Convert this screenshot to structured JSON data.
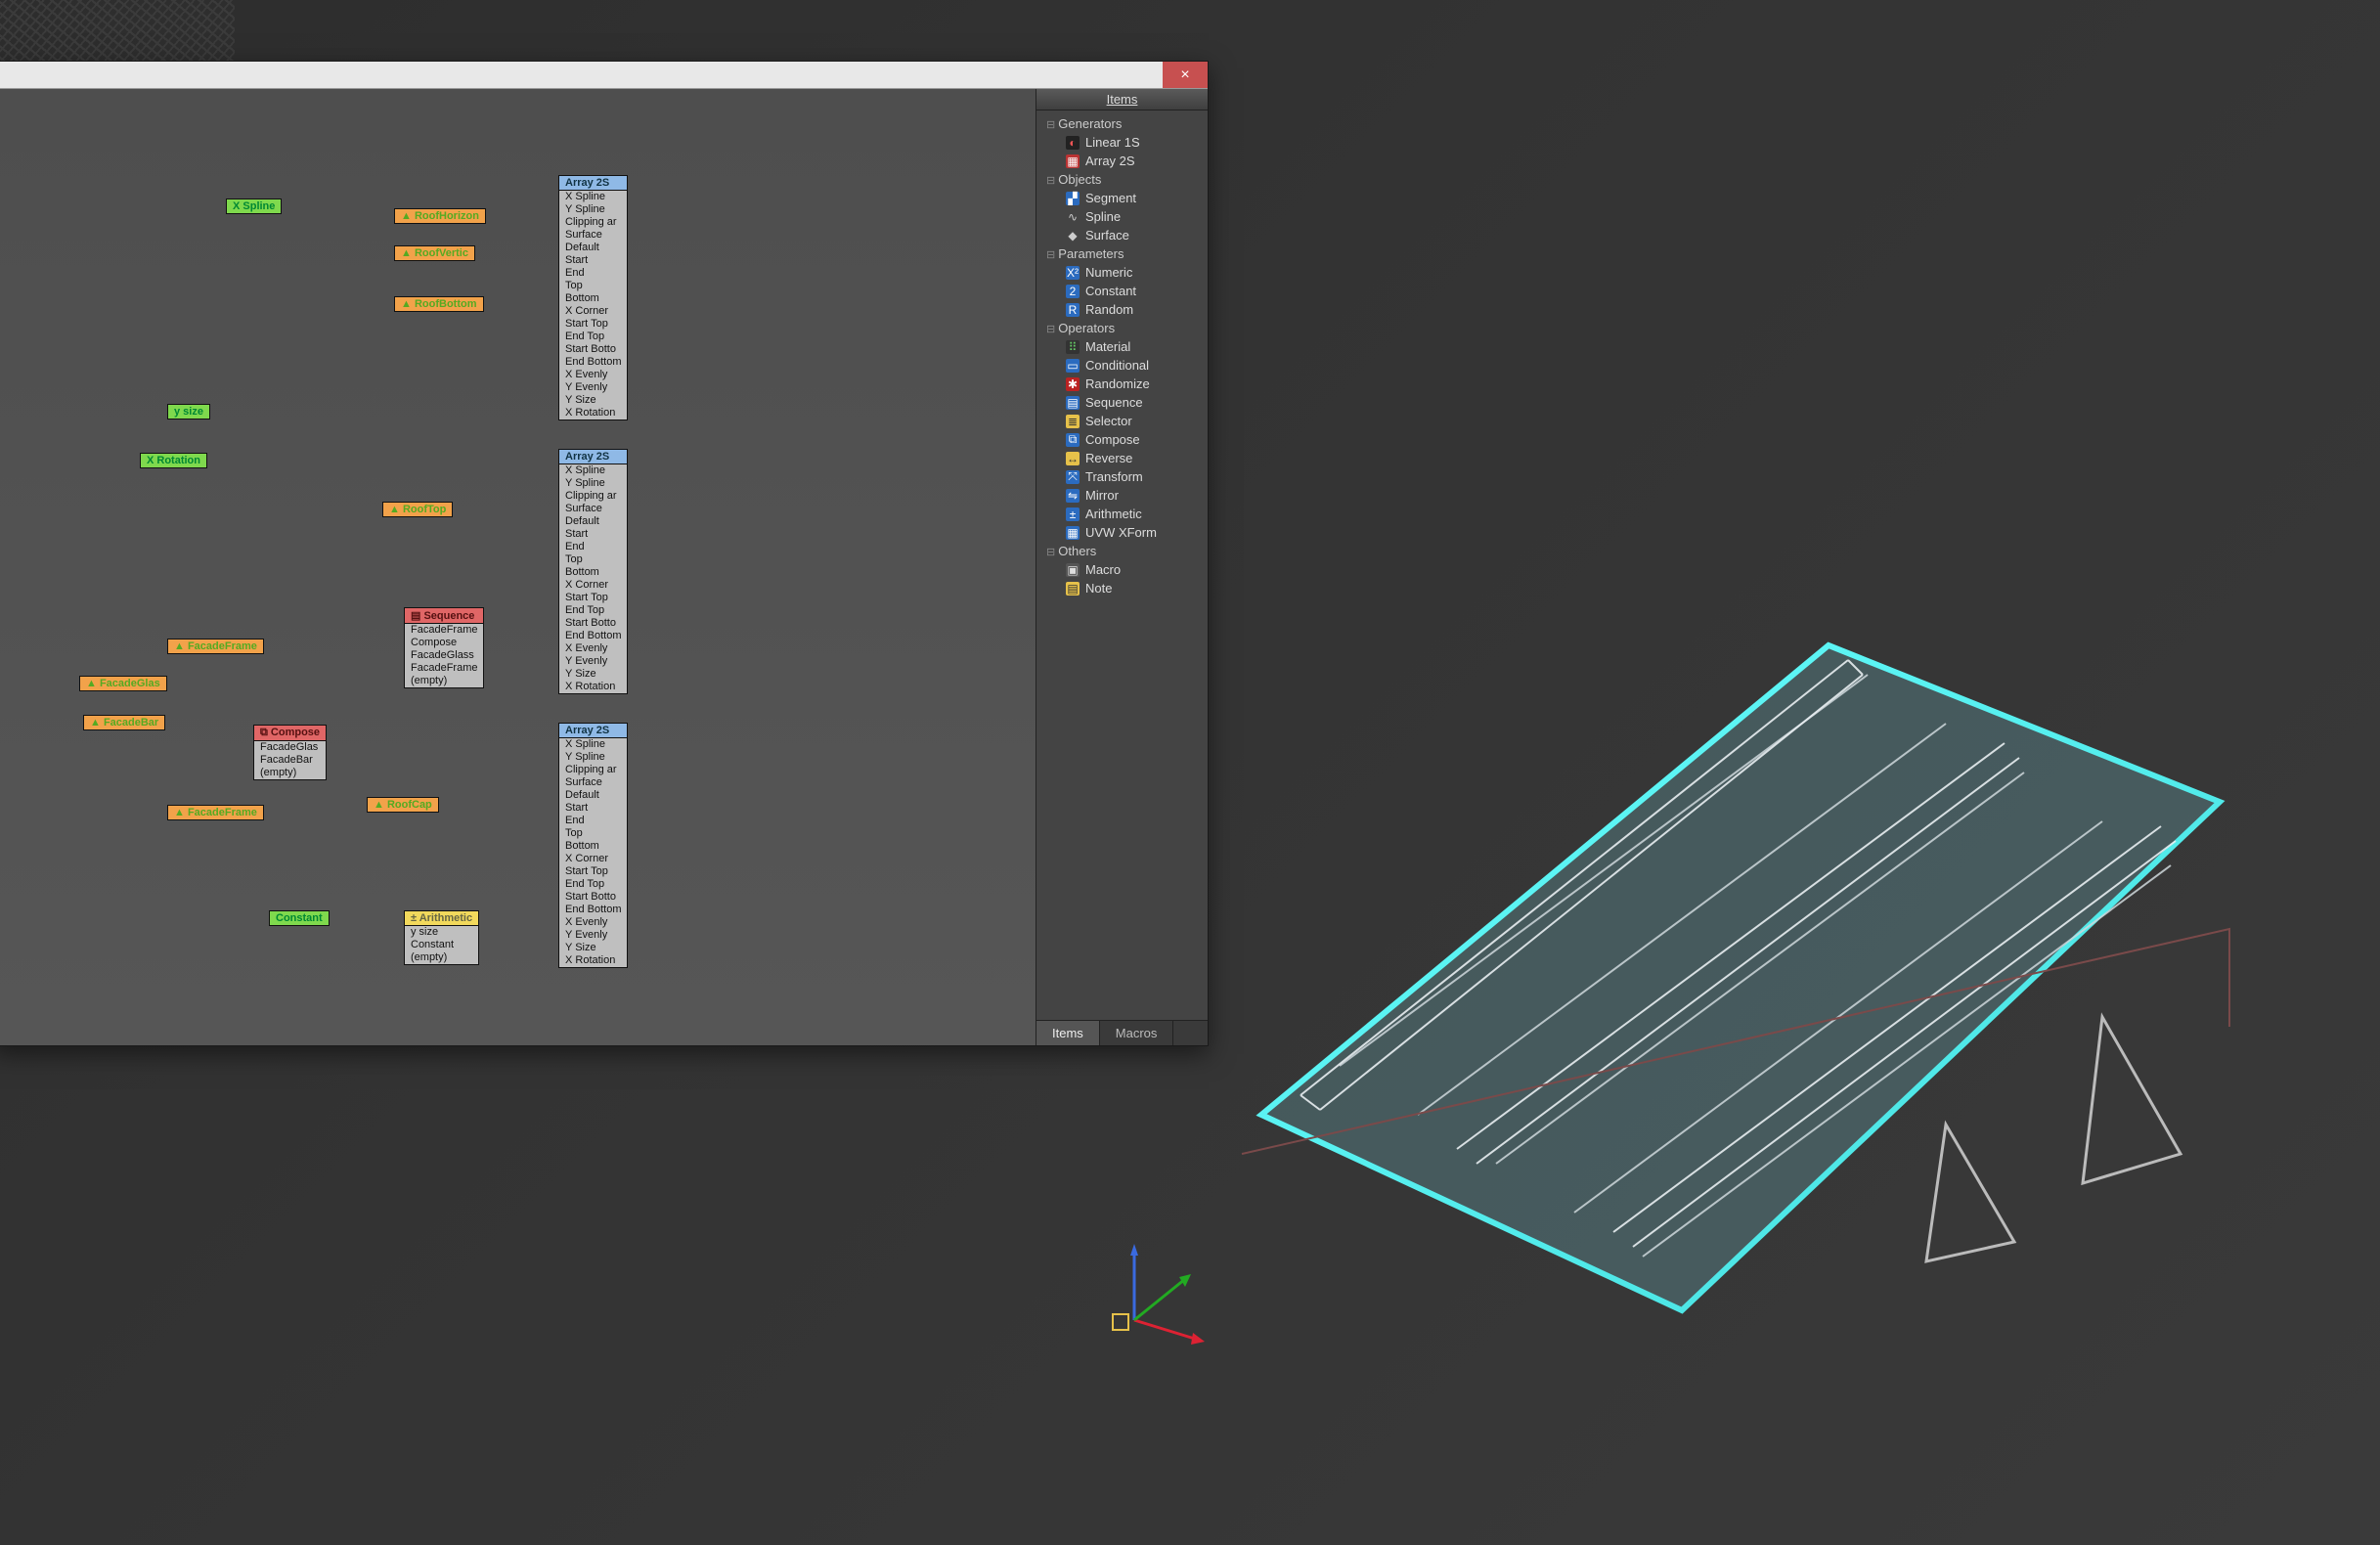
{
  "window": {
    "close_glyph": "×"
  },
  "sidepanel": {
    "title": "Items",
    "tabs": {
      "items": "Items",
      "macros": "Macros"
    },
    "categories": [
      {
        "name": "Generators",
        "items": [
          {
            "label": "Linear 1S",
            "icon": "linear-1s-icon",
            "glyph": "◐",
            "bg": "#222",
            "fg": "#e55"
          },
          {
            "label": "Array 2S",
            "icon": "array-2s-icon",
            "glyph": "▦",
            "bg": "#b33",
            "fg": "#fff"
          }
        ]
      },
      {
        "name": "Objects",
        "items": [
          {
            "label": "Segment",
            "icon": "segment-icon",
            "glyph": "▞",
            "bg": "#2b6bbf",
            "fg": "#fff"
          },
          {
            "label": "Spline",
            "icon": "spline-icon",
            "glyph": "∿",
            "bg": "#444",
            "fg": "#ccc"
          },
          {
            "label": "Surface",
            "icon": "surface-icon",
            "glyph": "◆",
            "bg": "#444",
            "fg": "#ccc"
          }
        ]
      },
      {
        "name": "Parameters",
        "items": [
          {
            "label": "Numeric",
            "icon": "numeric-icon",
            "glyph": "X²",
            "bg": "#2b6bbf",
            "fg": "#fff"
          },
          {
            "label": "Constant",
            "icon": "constant-icon",
            "glyph": "2",
            "bg": "#2b6bbf",
            "fg": "#fff"
          },
          {
            "label": "Random",
            "icon": "random-icon",
            "glyph": "R",
            "bg": "#2b6bbf",
            "fg": "#fff"
          }
        ]
      },
      {
        "name": "Operators",
        "items": [
          {
            "label": "Material",
            "icon": "material-icon",
            "glyph": "⠿",
            "bg": "#333",
            "fg": "#6c6"
          },
          {
            "label": "Conditional",
            "icon": "conditional-icon",
            "glyph": "▭",
            "bg": "#2b6bbf",
            "fg": "#fff"
          },
          {
            "label": "Randomize",
            "icon": "randomize-icon",
            "glyph": "✱",
            "bg": "#b22",
            "fg": "#fff"
          },
          {
            "label": "Sequence",
            "icon": "sequence-icon",
            "glyph": "▤",
            "bg": "#2b6bbf",
            "fg": "#fff"
          },
          {
            "label": "Selector",
            "icon": "selector-icon",
            "glyph": "≣",
            "bg": "#e6c14a",
            "fg": "#333"
          },
          {
            "label": "Compose",
            "icon": "compose-icon",
            "glyph": "⧉",
            "bg": "#2b6bbf",
            "fg": "#fff"
          },
          {
            "label": "Reverse",
            "icon": "reverse-icon",
            "glyph": "↔",
            "bg": "#e6c14a",
            "fg": "#333"
          },
          {
            "label": "Transform",
            "icon": "transform-icon",
            "glyph": "⤧",
            "bg": "#2b6bbf",
            "fg": "#fff"
          },
          {
            "label": "Mirror",
            "icon": "mirror-icon",
            "glyph": "⇋",
            "bg": "#2b6bbf",
            "fg": "#fff"
          },
          {
            "label": "Arithmetic",
            "icon": "arithmetic-icon",
            "glyph": "±",
            "bg": "#2b6bbf",
            "fg": "#fff"
          },
          {
            "label": "UVW XForm",
            "icon": "uvw-xform-icon",
            "glyph": "▦",
            "bg": "#2b6bbf",
            "fg": "#fff"
          }
        ]
      },
      {
        "name": "Others",
        "items": [
          {
            "label": "Macro",
            "icon": "macro-icon",
            "glyph": "▣",
            "bg": "#555",
            "fg": "#ddd"
          },
          {
            "label": "Note",
            "icon": "note-icon",
            "glyph": "▤",
            "bg": "#e6c14a",
            "fg": "#333"
          }
        ]
      }
    ]
  },
  "nodes": {
    "xspline": {
      "label": "X Spline"
    },
    "ysize": {
      "label": "y size"
    },
    "xrot": {
      "label": "X Rotation"
    },
    "constant": {
      "label": "Constant"
    },
    "roofhoriz": {
      "label": "RoofHorizon"
    },
    "roofvert": {
      "label": "RoofVertic"
    },
    "roofbot": {
      "label": "RoofBottom"
    },
    "rooftop": {
      "label": "RoofTop"
    },
    "roofcap": {
      "label": "RoofCap"
    },
    "facframe1": {
      "label": "FacadeFrame"
    },
    "facglas": {
      "label": "FacadeGlas"
    },
    "facbar": {
      "label": "FacadeBar"
    },
    "facframe2": {
      "label": "FacadeFrame"
    },
    "compose": {
      "title": "Compose",
      "rows": [
        "FacadeGlas",
        "FacadeBar",
        "(empty)"
      ]
    },
    "sequence": {
      "title": "Sequence",
      "rows": [
        "FacadeFrame",
        "Compose",
        "FacadeGlass",
        "FacadeFrame",
        "(empty)"
      ]
    },
    "arith": {
      "title": "Arithmetic",
      "rows": [
        "y size",
        "Constant",
        "(empty)"
      ]
    },
    "array_rows": [
      "X Spline",
      "Y Spline",
      "Clipping ar",
      "Surface",
      "Default",
      "Start",
      "End",
      "Top",
      "Bottom",
      "X Corner",
      "Start Top",
      "End Top",
      "Start Botto",
      "End Bottom",
      "X Evenly",
      "Y Evenly",
      "Y Size",
      "X Rotation"
    ],
    "array_title": "Array 2S"
  }
}
